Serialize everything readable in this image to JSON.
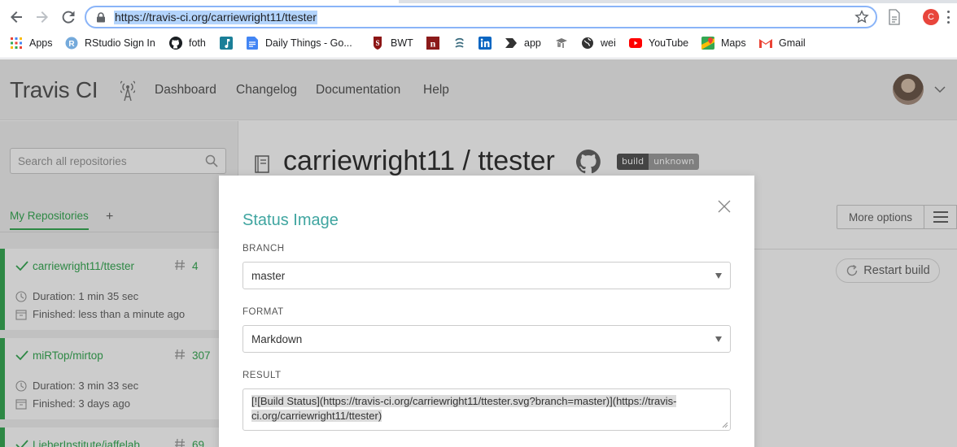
{
  "browser": {
    "url": "https://travis-ci.org/carriewright11/ttester",
    "profile_initial": "C",
    "bookmarks": [
      {
        "label": "Apps",
        "icon": "apps-grid-icon"
      },
      {
        "label": "RStudio Sign In",
        "icon": "rstudio-icon"
      },
      {
        "label": "foth",
        "icon": "github-icon"
      },
      {
        "label": "",
        "icon": "music-note-icon"
      },
      {
        "label": "Daily Things - Go...",
        "icon": "google-docs-icon"
      },
      {
        "label": "BWT",
        "icon": "stanford-icon"
      },
      {
        "label": "",
        "icon": "n-icon"
      },
      {
        "label": "",
        "icon": "swirl-icon"
      },
      {
        "label": "",
        "icon": "linkedin-icon"
      },
      {
        "label": "app",
        "icon": "arrow-tag-icon"
      },
      {
        "label": "",
        "icon": "graduation-cap-icon"
      },
      {
        "label": "wei",
        "icon": "globe-icon"
      },
      {
        "label": "YouTube",
        "icon": "youtube-icon"
      },
      {
        "label": "Maps",
        "icon": "maps-icon"
      },
      {
        "label": "Gmail",
        "icon": "gmail-icon"
      }
    ]
  },
  "travis": {
    "brand": "Travis CI",
    "nav": [
      "Dashboard",
      "Changelog",
      "Documentation",
      "Help"
    ],
    "search_placeholder": "Search all repositories",
    "tab_my_repos": "My Repositories",
    "tab_add": "+",
    "repos": [
      {
        "name": "carriewright11/ttester",
        "number": "4",
        "duration": "Duration: 1 min 35 sec",
        "finished": "Finished: less than a minute ago"
      },
      {
        "name": "miRTop/mirtop",
        "number": "307",
        "duration": "Duration: 3 min 33 sec",
        "finished": "Finished: 3 days ago"
      },
      {
        "name": "LieberInstitute/jaffelab",
        "number": "69",
        "duration": "",
        "finished": ""
      }
    ],
    "repo_title": "carriewright11 / ttester",
    "badge_left": "build",
    "badge_right": "unknown",
    "more_options": "More options",
    "restart_build": "Restart build"
  },
  "modal": {
    "title": "Status Image",
    "branch_label": "BRANCH",
    "branch_value": "master",
    "format_label": "FORMAT",
    "format_value": "Markdown",
    "result_label": "RESULT",
    "result_line1": "[![Build Status](https://travis-ci.org/carriewright11/ttester.svg?branch=master)](https://travis-",
    "result_line2": "ci.org/carriewright11/ttester)"
  },
  "colors": {
    "travis_green": "#39aa56",
    "modal_title": "#3fa5a0",
    "omnibox_focus": "#8ab4f8"
  }
}
